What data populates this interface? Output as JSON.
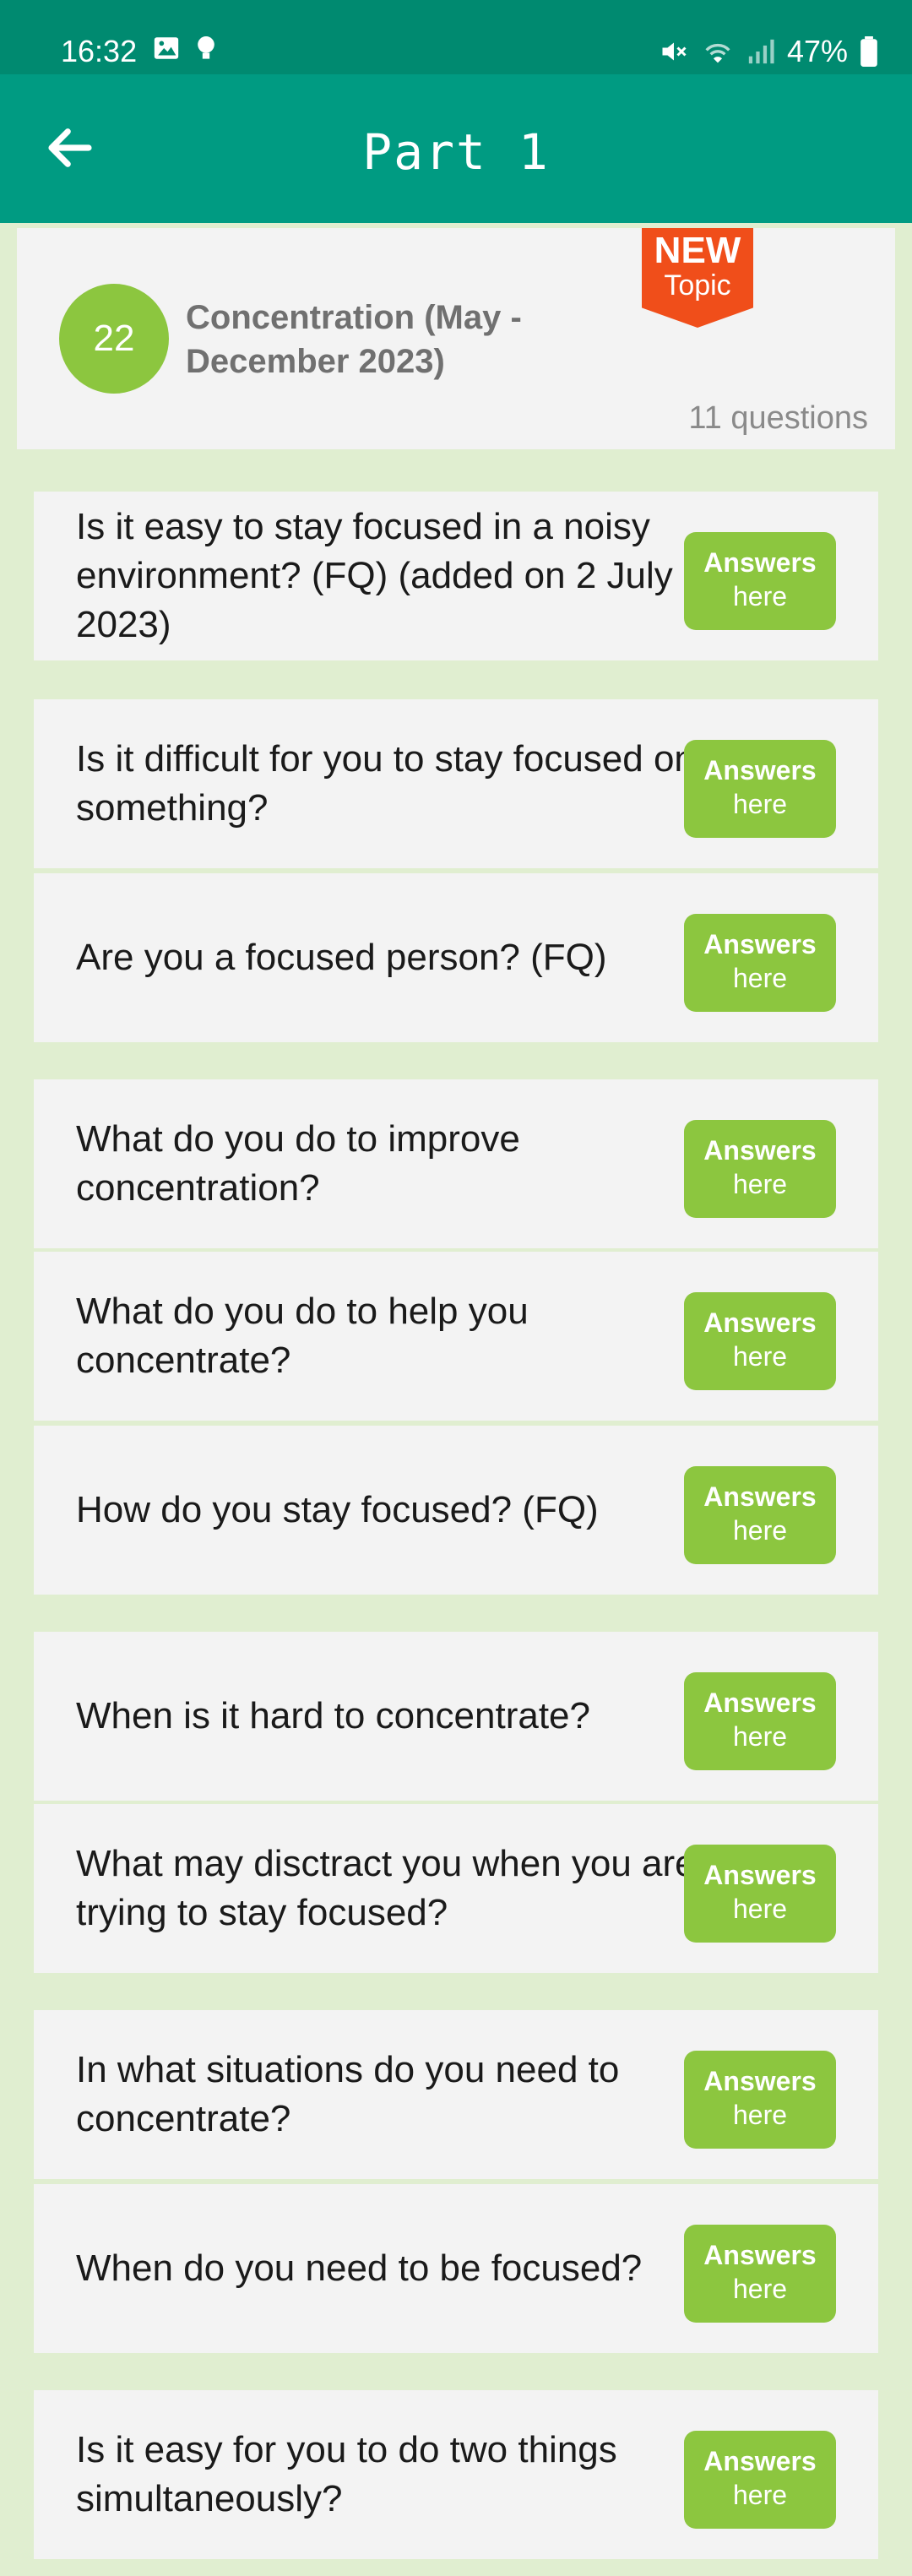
{
  "status": {
    "time": "16:32",
    "battery": "47%"
  },
  "header": {
    "title": "Part 1"
  },
  "topic": {
    "number": "22",
    "title": "Concentration (May - December 2023)",
    "count": "11 questions",
    "badge_new": "NEW",
    "badge_topic": "Topic"
  },
  "answer_btn": {
    "line1": "Answers",
    "line2": "here"
  },
  "questions": [
    "Is it easy to stay focused in a noisy environment? (FQ) (added on 2 July 2023)",
    "Is it difficult for you to stay focused on something?",
    "Are you a focused person? (FQ)",
    "What do you do to improve concentration?",
    "What do you do to help you concentrate?",
    "How do you stay focused? (FQ)",
    "When is it hard to concentrate?",
    "What may disctract you when you are trying to stay focused?",
    "In what situations do you need to concentrate?",
    "When do you need to be focused?",
    "Is it easy for you to do two things simultaneously?"
  ],
  "colors": {
    "header": "#009b82",
    "accent": "#8cc63f",
    "badge": "#f04e1a",
    "background": "#e0eed0"
  },
  "icons": {
    "back": "arrow-left-icon"
  }
}
